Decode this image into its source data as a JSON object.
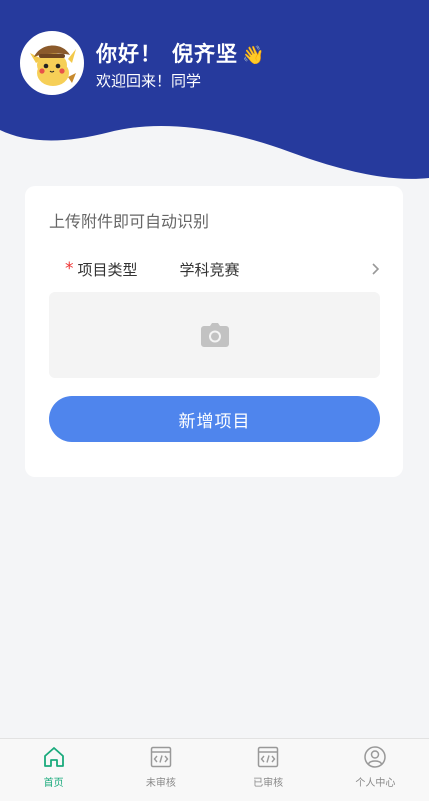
{
  "header": {
    "greeting": "你好！",
    "name": "倪齐坚",
    "wave": "👋",
    "welcome": "欢迎回来！同学",
    "bg_color": "#263a9d"
  },
  "card": {
    "hint": "上传附件即可自动识别",
    "required_mark": "*",
    "type_label": "项目类型",
    "type_value": "学科竞赛",
    "add_button": "新增项目",
    "button_color": "#4f85ed"
  },
  "tabbar": {
    "active_color": "#1aaa7c",
    "items": [
      {
        "label": "首页",
        "icon": "home-icon"
      },
      {
        "label": "未审核",
        "icon": "code-doc-icon"
      },
      {
        "label": "已审核",
        "icon": "code-doc-icon"
      },
      {
        "label": "个人中心",
        "icon": "user-icon"
      }
    ]
  }
}
